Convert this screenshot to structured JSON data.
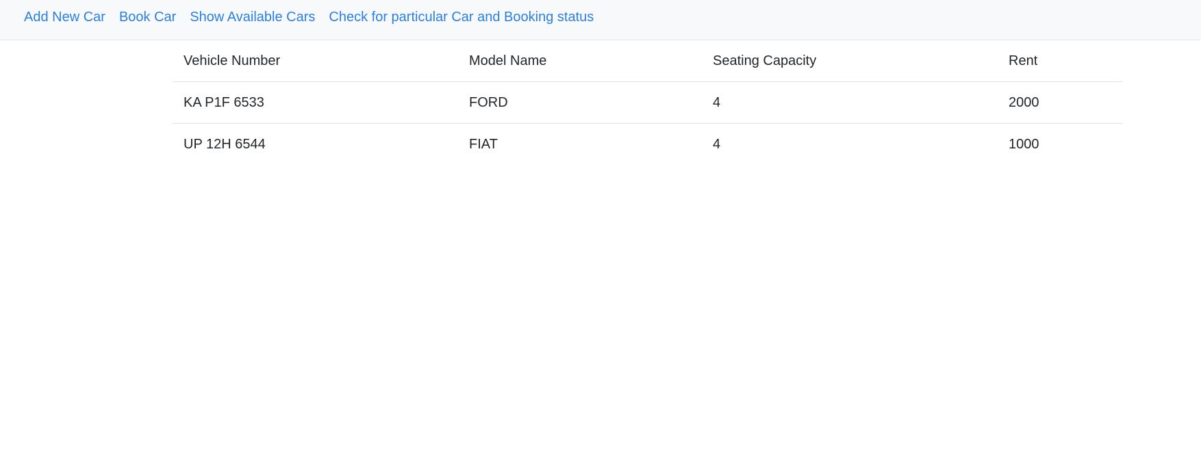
{
  "nav": {
    "items": [
      {
        "label": "Add New Car"
      },
      {
        "label": "Book Car"
      },
      {
        "label": "Show Available Cars"
      },
      {
        "label": "Check for particular Car and Booking status"
      }
    ]
  },
  "table": {
    "headers": [
      "Vehicle Number",
      "Model Name",
      "Seating Capacity",
      "Rent"
    ],
    "rows": [
      [
        "KA P1F 6533",
        "FORD",
        "4",
        "2000"
      ],
      [
        "UP 12H 6544",
        "FIAT",
        "4",
        "1000"
      ]
    ]
  },
  "colors": {
    "link": "#2a7fe3",
    "navbar_bg": "#f8f9fa",
    "text": "#212529",
    "border": "#dee2e6"
  }
}
